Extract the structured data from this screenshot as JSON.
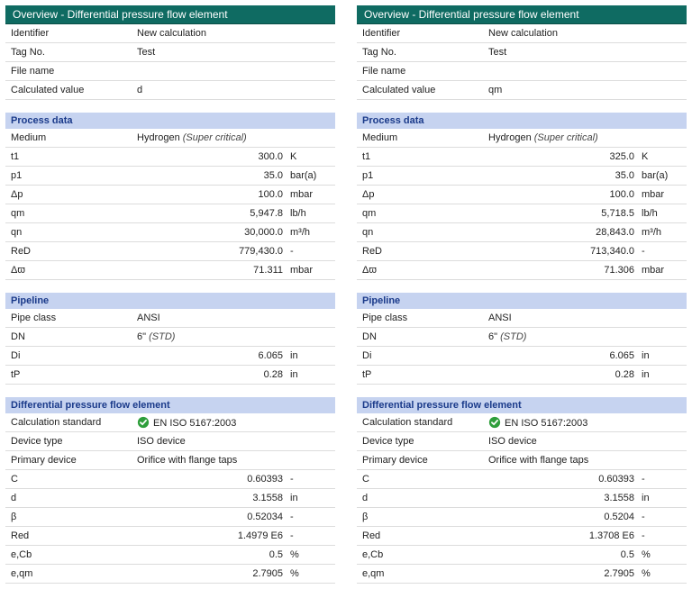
{
  "panels": [
    {
      "header": "Overview - Differential pressure flow element",
      "overview": {
        "identifier_label": "Identifier",
        "identifier_value": "New calculation",
        "tag_label": "Tag No.",
        "tag_value": "Test",
        "filename_label": "File name",
        "filename_value": "",
        "calcval_label": "Calculated value",
        "calcval_value": "d"
      },
      "process": {
        "section_title": "Process data",
        "medium_label": "Medium",
        "medium_value": "Hydrogen",
        "medium_note": "(Super critical)",
        "t1_label": "t1",
        "t1_value": "300.0",
        "t1_unit": "K",
        "p1_label": "p1",
        "p1_value": "35.0",
        "p1_unit": "bar(a)",
        "dp_label": "Δp",
        "dp_value": "100.0",
        "dp_unit": "mbar",
        "qm_label": "qm",
        "qm_value": "5,947.8",
        "qm_unit": "lb/h",
        "qn_label": "qn",
        "qn_value": "30,000.0",
        "qn_unit": "m³/h",
        "red_label": "ReD",
        "red_value": "779,430.0",
        "red_unit": "-",
        "dw_label": "Δϖ",
        "dw_value": "71.311",
        "dw_unit": "mbar"
      },
      "pipeline": {
        "section_title": "Pipeline",
        "class_label": "Pipe class",
        "class_value": "ANSI",
        "dn_label": "DN",
        "dn_value": "6\"",
        "dn_note": "(STD)",
        "di_label": "Di",
        "di_value": "6.065",
        "di_unit": "in",
        "tp_label": "tP",
        "tp_value": "0.28",
        "tp_unit": "in"
      },
      "element": {
        "section_title": "Differential pressure flow element",
        "std_label": "Calculation standard",
        "std_value": "EN ISO 5167:2003",
        "devtype_label": "Device type",
        "devtype_value": "ISO device",
        "prim_label": "Primary device",
        "prim_value": "Orifice with flange taps",
        "c_label": "C",
        "c_value": "0.60393",
        "c_unit": "-",
        "d_label": "d",
        "d_value": "3.1558",
        "d_unit": "in",
        "b_label": "β",
        "b_value": "0.52034",
        "b_unit": "-",
        "red_label": "Red",
        "red_value": "1.4979 E6",
        "red_unit": "-",
        "ecb_label": "e,Cb",
        "ecb_value": "0.5",
        "ecb_unit": "%",
        "eqm_label": "e,qm",
        "eqm_value": "2.7905",
        "eqm_unit": "%"
      }
    },
    {
      "header": "Overview - Differential pressure flow element",
      "overview": {
        "identifier_label": "Identifier",
        "identifier_value": "New calculation",
        "tag_label": "Tag No.",
        "tag_value": "Test",
        "filename_label": "File name",
        "filename_value": "",
        "calcval_label": "Calculated value",
        "calcval_value": "qm"
      },
      "process": {
        "section_title": "Process data",
        "medium_label": "Medium",
        "medium_value": "Hydrogen",
        "medium_note": "(Super critical)",
        "t1_label": "t1",
        "t1_value": "325.0",
        "t1_unit": "K",
        "p1_label": "p1",
        "p1_value": "35.0",
        "p1_unit": "bar(a)",
        "dp_label": "Δp",
        "dp_value": "100.0",
        "dp_unit": "mbar",
        "qm_label": "qm",
        "qm_value": "5,718.5",
        "qm_unit": "lb/h",
        "qn_label": "qn",
        "qn_value": "28,843.0",
        "qn_unit": "m³/h",
        "red_label": "ReD",
        "red_value": "713,340.0",
        "red_unit": "-",
        "dw_label": "Δϖ",
        "dw_value": "71.306",
        "dw_unit": "mbar"
      },
      "pipeline": {
        "section_title": "Pipeline",
        "class_label": "Pipe class",
        "class_value": "ANSI",
        "dn_label": "DN",
        "dn_value": "6\"",
        "dn_note": "(STD)",
        "di_label": "Di",
        "di_value": "6.065",
        "di_unit": "in",
        "tp_label": "tP",
        "tp_value": "0.28",
        "tp_unit": "in"
      },
      "element": {
        "section_title": "Differential pressure flow element",
        "std_label": "Calculation standard",
        "std_value": "EN ISO 5167:2003",
        "devtype_label": "Device type",
        "devtype_value": "ISO device",
        "prim_label": "Primary device",
        "prim_value": "Orifice with flange taps",
        "c_label": "C",
        "c_value": "0.60393",
        "c_unit": "-",
        "d_label": "d",
        "d_value": "3.1558",
        "d_unit": "in",
        "b_label": "β",
        "b_value": "0.5204",
        "b_unit": "-",
        "red_label": "Red",
        "red_value": "1.3708 E6",
        "red_unit": "-",
        "ecb_label": "e,Cb",
        "ecb_value": "0.5",
        "ecb_unit": "%",
        "eqm_label": "e,qm",
        "eqm_value": "2.7905",
        "eqm_unit": "%"
      }
    }
  ]
}
